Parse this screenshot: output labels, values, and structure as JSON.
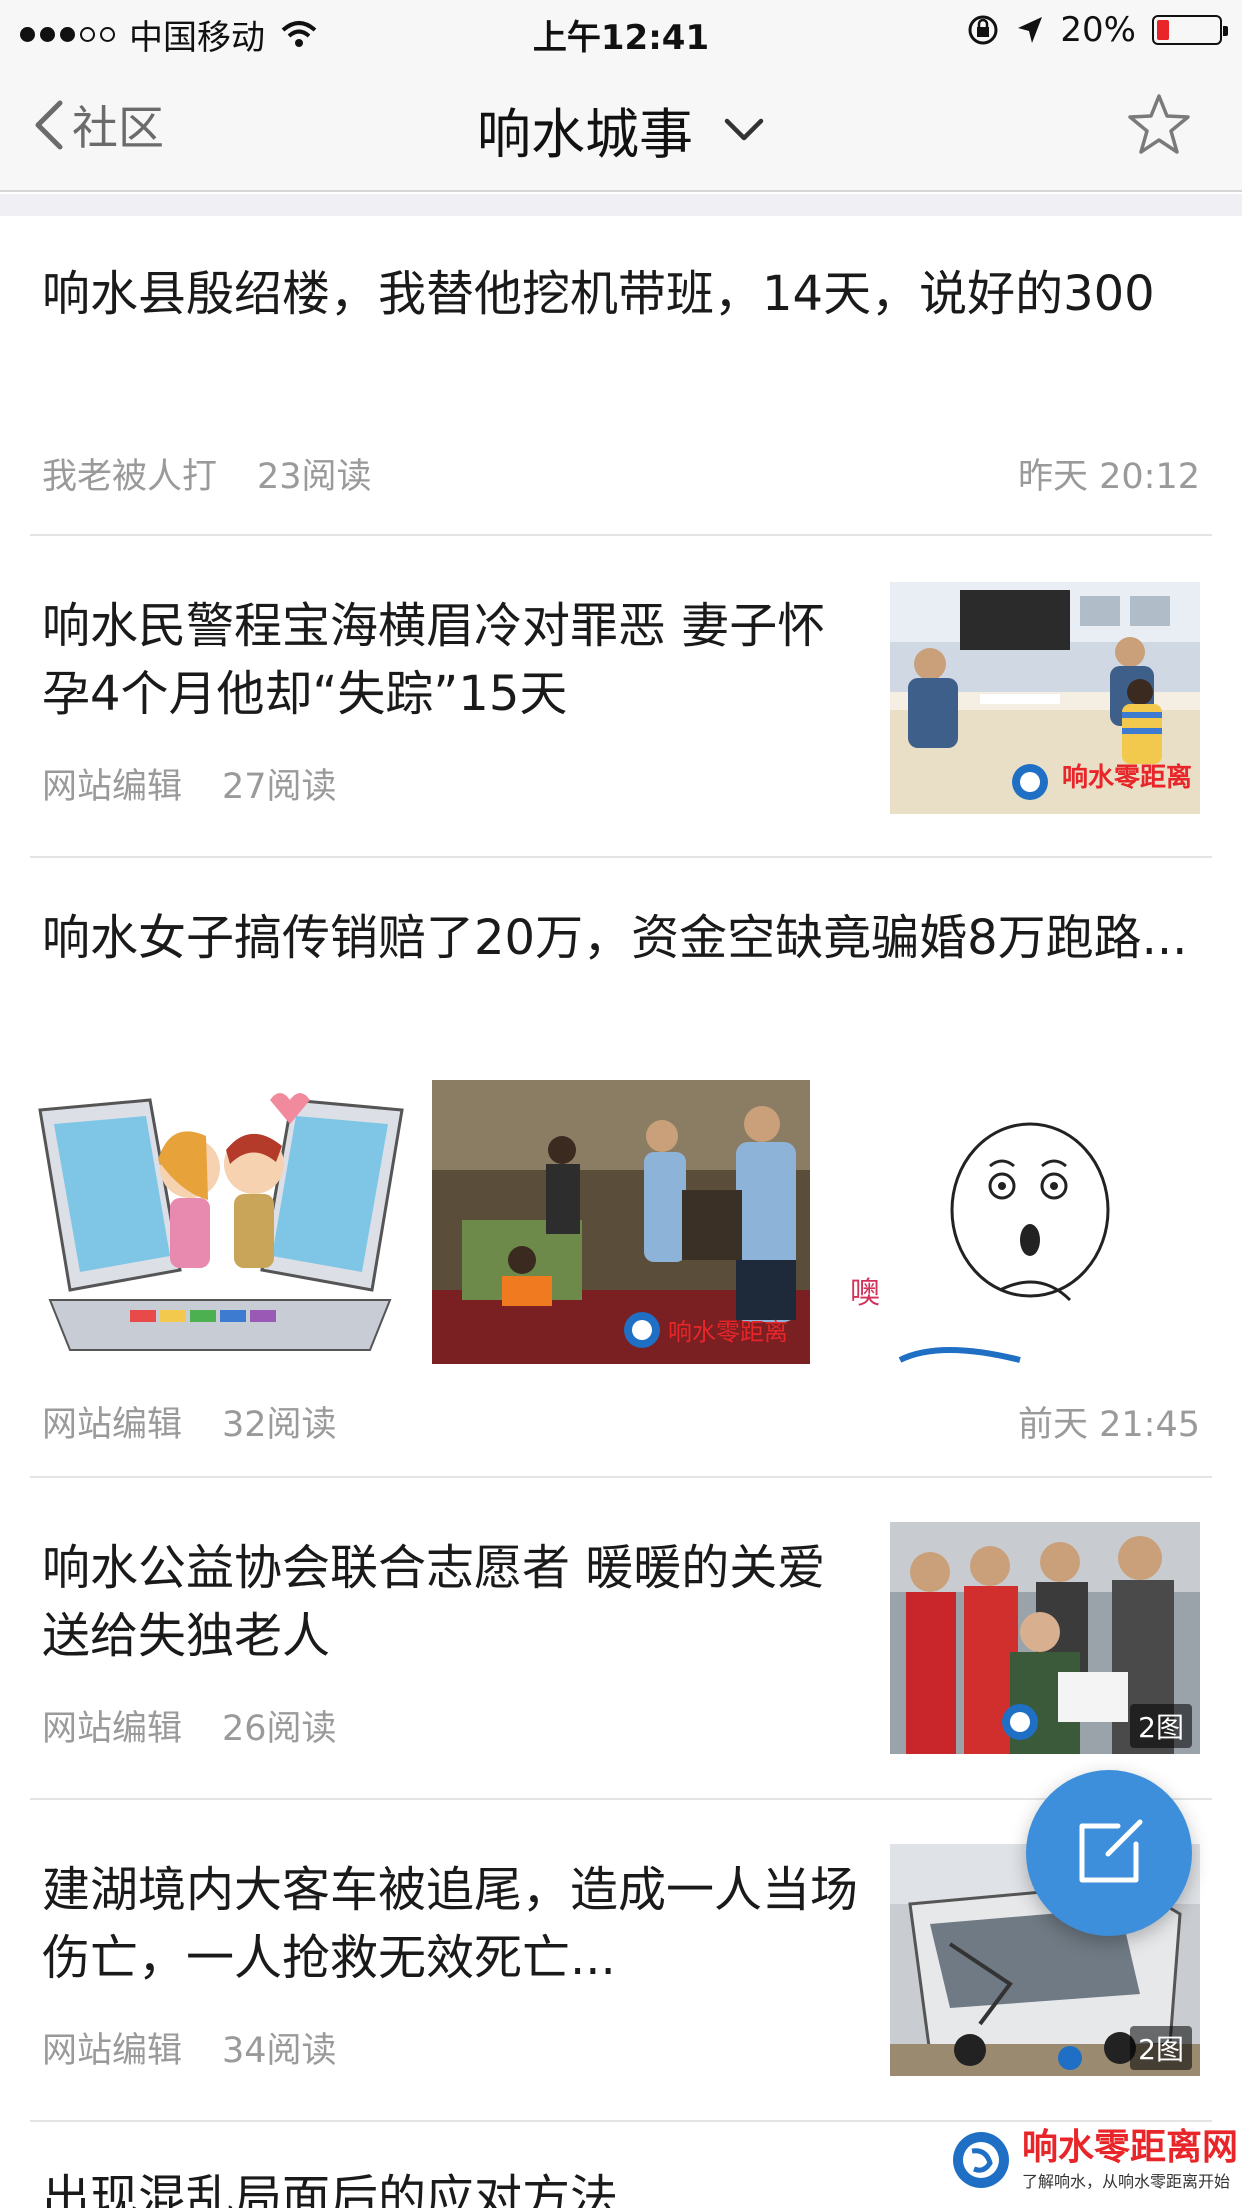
{
  "status_bar": {
    "carrier": "中国移动",
    "time": "上午12:41",
    "battery_percent": "20%",
    "battery_level": 0.2,
    "accent_red": "#e8262a"
  },
  "nav": {
    "back_label": "社区",
    "title": "响水城事",
    "icons": [
      "chevron-left-icon",
      "chevron-down-icon",
      "star-icon"
    ]
  },
  "articles": [
    {
      "title": "响水县殷绍楼，我替他挖机带班，14天，说好的300",
      "author": "我老被人打",
      "reads": "23阅读",
      "time": "昨天 20:12"
    },
    {
      "title": "响水民警程宝海横眉冷对罪恶 妻子怀孕4个月他却“失踪”15天",
      "author": "网站编辑",
      "reads": "27阅读",
      "watermark": "响水零距离"
    },
    {
      "title": "响水女子搞传销赔了20万，资金空缺竟骗婚8万跑路...",
      "author": "网站编辑",
      "reads": "32阅读",
      "time": "前天 21:45",
      "image_caption": "噢"
    },
    {
      "title": "响水公益协会联合志愿者 暖暖的关爱送给失独老人",
      "author": "网站编辑",
      "reads": "26阅读",
      "badge": "2图"
    },
    {
      "title": "建湖境内大客车被追尾，造成一人当场伤亡，一人抢救无效死亡...",
      "author": "网站编辑",
      "reads": "34阅读",
      "badge": "2图"
    },
    {
      "title": "出现混乱局面后的应对方法"
    }
  ],
  "fab": {
    "icon": "compose-icon",
    "color": "#3e8fdb"
  },
  "brand": {
    "name": "响水零距离网",
    "tagline": "了解响水，从响水零距离开始"
  }
}
